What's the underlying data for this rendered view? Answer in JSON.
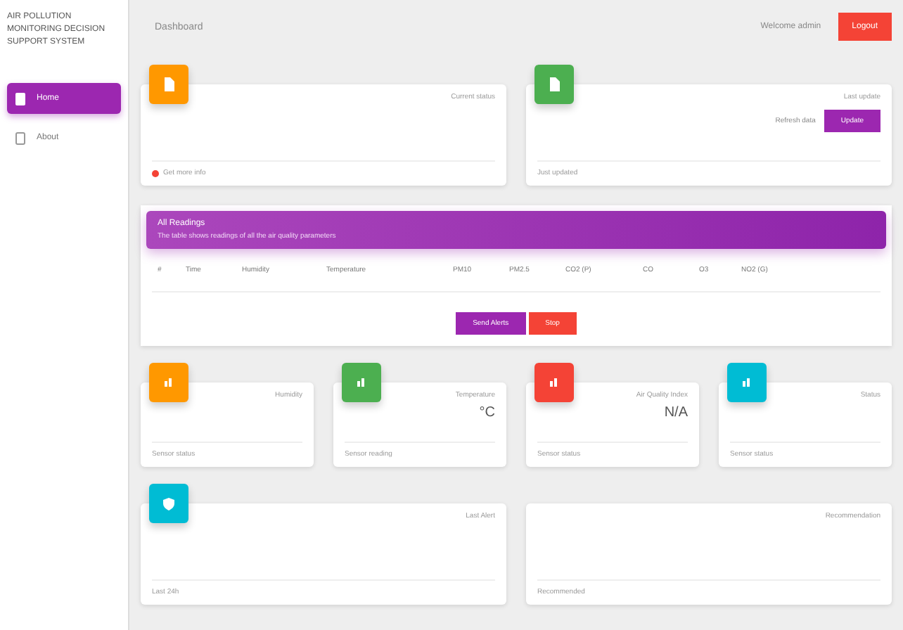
{
  "sidebar": {
    "title": "AIR POLLUTION MONITORING DECISION SUPPORT SYSTEM",
    "items": [
      {
        "label": "Home",
        "kind": "page",
        "selected": true
      },
      {
        "label": "About",
        "kind": "phone",
        "selected": false
      }
    ]
  },
  "topbar": {
    "title": "Dashboard",
    "user": "Welcome admin",
    "logout": "Logout"
  },
  "top_cards": [
    {
      "color": "#ff9800",
      "label": "Current status",
      "footer": "Get more info",
      "kind": "alert"
    },
    {
      "color": "#4caf50",
      "label": "Last update",
      "note": "Refresh data",
      "button": "Update",
      "footer": "Just updated",
      "kind": "plain"
    }
  ],
  "table": {
    "title": "All Readings",
    "subtitle": "The table shows readings of all the air quality parameters",
    "columns": [
      "#",
      "Time",
      "Humidity",
      "Temperature",
      "PM10",
      "PM2.5",
      "CO2 (P)",
      "CO",
      "O3",
      "NO2 (G)"
    ],
    "buttons": [
      {
        "label": "Send Alerts",
        "kind": "primary"
      },
      {
        "label": "Stop",
        "kind": "danger"
      }
    ]
  },
  "stats": [
    {
      "color": "#ff9800",
      "label": "Humidity",
      "footer": "Sensor status"
    },
    {
      "color": "#4caf50",
      "label": "Temperature",
      "value": "°C",
      "footer": "Sensor reading"
    },
    {
      "color": "#f44336",
      "label": "Air Quality Index",
      "value": "N/A",
      "footer": "Sensor status"
    },
    {
      "color": "#00bcd4",
      "label": "Status",
      "footer": "Sensor status"
    }
  ],
  "bottom": [
    {
      "color": "#00bcd4",
      "label": "Last Alert",
      "footer": "Last 24h"
    },
    {
      "label": "Recommendation",
      "footer": "Recommended"
    }
  ]
}
